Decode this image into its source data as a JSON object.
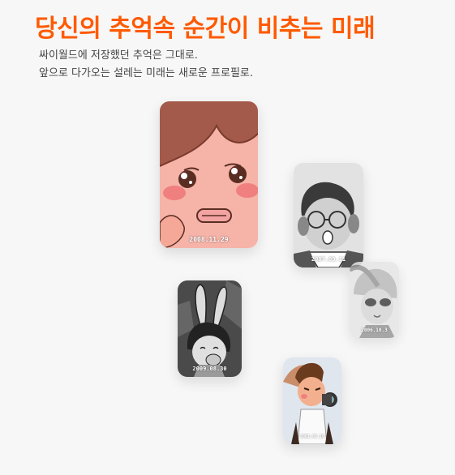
{
  "header": {
    "title": "당신의 추억속 순간이 비추는 미래",
    "desc_line1": "싸이월드에 저장했던 추억은 그대로.",
    "desc_line2": "앞으로 다가오는 설레는 미래는 새로운 프로필로."
  },
  "cards": [
    {
      "name": "card-pink-crying",
      "date": "2008.11.29",
      "style": "color"
    },
    {
      "name": "card-glasses-man",
      "date": "2007.09.11",
      "style": "grayscale"
    },
    {
      "name": "card-sunglasses",
      "date": "2006.10.3",
      "style": "grayscale-faded"
    },
    {
      "name": "card-bunny-girl",
      "date": "2009.08.30",
      "style": "grayscale"
    },
    {
      "name": "card-camera-man",
      "date": "2001.07.10",
      "style": "color"
    }
  ],
  "colors": {
    "accent": "#ff5a00",
    "background": "#f7f7f7"
  }
}
